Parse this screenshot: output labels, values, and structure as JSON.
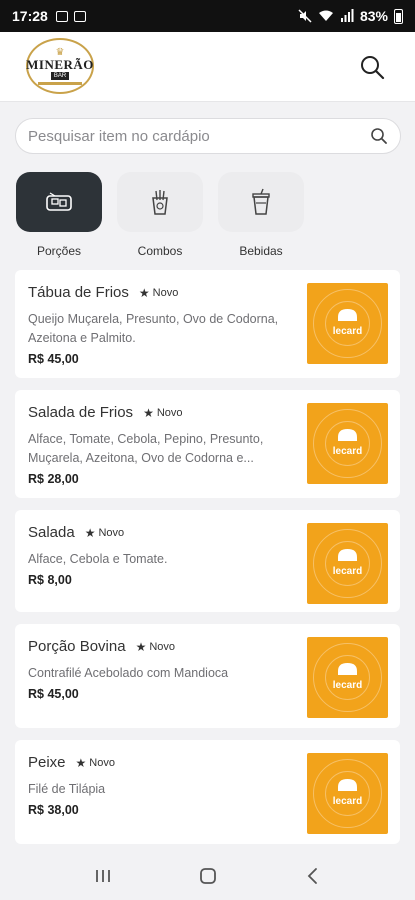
{
  "status_bar": {
    "time": "17:28",
    "battery": "83%"
  },
  "header": {
    "logo_text": "MINERÃO",
    "logo_sub": "BAR"
  },
  "search": {
    "placeholder": "Pesquisar item no cardápio"
  },
  "categories": [
    {
      "label": "Porções",
      "active": true
    },
    {
      "label": "Combos",
      "active": false
    },
    {
      "label": "Bebidas",
      "active": false
    }
  ],
  "items": [
    {
      "name": "Tábua de Frios",
      "badge": "Novo",
      "desc": "Queijo Muçarela, Presunto, Ovo de Codorna, Azeitona e Palmito.",
      "price": "R$ 45,00"
    },
    {
      "name": "Salada de Frios",
      "badge": "Novo",
      "desc": "Alface, Tomate, Cebola, Pepino, Presunto, Muçarela, Azeitona, Ovo de Codorna e...",
      "price": "R$ 28,00"
    },
    {
      "name": "Salada",
      "badge": "Novo",
      "desc": "Alface, Cebola e Tomate.",
      "price": "R$ 8,00"
    },
    {
      "name": "Porção Bovina",
      "badge": "Novo",
      "desc": "Contrafilé Acebolado com Mandioca",
      "price": "R$ 45,00"
    },
    {
      "name": "Peixe",
      "badge": "Novo",
      "desc": "Filé de Tilápia",
      "price": "R$ 38,00"
    }
  ],
  "placeholder_image_text": "lecard",
  "colors": {
    "accent_orange": "#f2a31b",
    "active_tile": "#2d3338",
    "logo_gold": "#c9a24a"
  }
}
